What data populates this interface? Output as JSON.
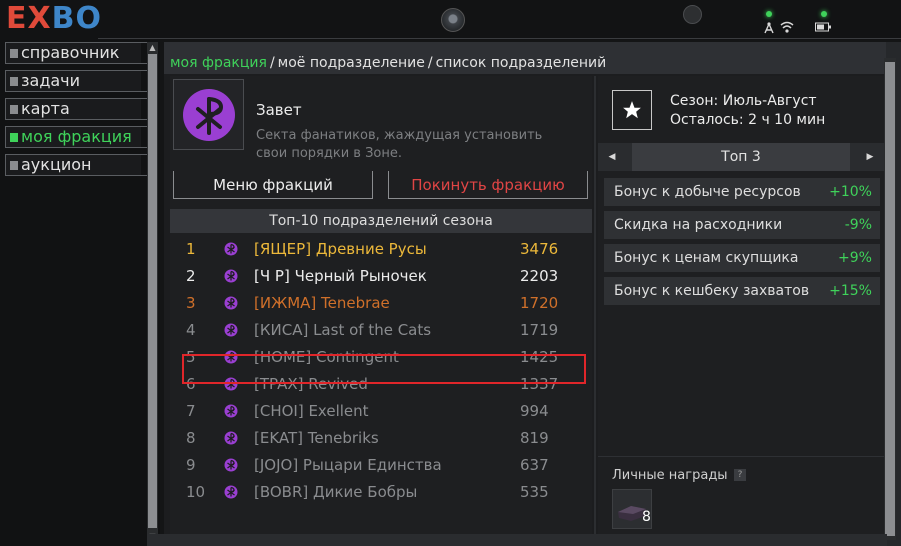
{
  "app": {
    "logo_part1": "EX",
    "logo_part2": "BO"
  },
  "sidebar": {
    "items": [
      {
        "label": "справочник",
        "active": false
      },
      {
        "label": "задачи",
        "active": false
      },
      {
        "label": "карта",
        "active": false
      },
      {
        "label": "моя фракция",
        "active": true
      },
      {
        "label": "аукцион",
        "active": false
      }
    ]
  },
  "breadcrumb": {
    "items": [
      "моя фракция",
      "моё подразделение",
      "список подразделений"
    ],
    "separator": "/"
  },
  "faction": {
    "name": "Завет",
    "description": "Секта фанатиков, жаждущая установить свои порядки в Зоне.",
    "emblem_icon": "chi-rho-emblem-icon",
    "menu_button": "Меню фракций",
    "leave_button": "Покинуть фракцию"
  },
  "leaderboard": {
    "title": "Топ-10 подразделений сезона",
    "rows": [
      {
        "rank": "1",
        "name": "[ЯЩЕР] Древние Русы",
        "score": "3476",
        "color": "#ecb83a"
      },
      {
        "rank": "2",
        "name": "[Ч  Р] Черный Рыночек",
        "score": "2203",
        "color": "#ececec"
      },
      {
        "rank": "3",
        "name": "[ИЖМА] Tenebrae",
        "score": "1720",
        "color": "#d0702a"
      },
      {
        "rank": "4",
        "name": "[КИСА] Last of the Cats",
        "score": "1719",
        "color": "#8a8c8f",
        "highlighted": true
      },
      {
        "rank": "5",
        "name": "[HOME] Contingent",
        "score": "1425",
        "color": "#8a8c8f"
      },
      {
        "rank": "6",
        "name": "[TPAX] Revived",
        "score": "1337",
        "color": "#8a8c8f"
      },
      {
        "rank": "7",
        "name": "[CHOI] Exellent",
        "score": "994",
        "color": "#8a8c8f"
      },
      {
        "rank": "8",
        "name": "[EKAT] Tenebriks",
        "score": "819",
        "color": "#8a8c8f"
      },
      {
        "rank": "9",
        "name": "[JOJO] Рыцари Единства",
        "score": "637",
        "color": "#8a8c8f"
      },
      {
        "rank": "10",
        "name": "[BOBR] Дикие Бобры",
        "score": "535",
        "color": "#8a8c8f"
      }
    ]
  },
  "season": {
    "title": "Сезон: Июль-Август",
    "remaining": "Осталось: 2 ч 10 мин",
    "icon": "star-icon",
    "selector": "Топ 3"
  },
  "bonuses": [
    {
      "label": "Бонус к добыче ресурсов",
      "value": "+10%"
    },
    {
      "label": "Скидка на расходники",
      "value": "-9%"
    },
    {
      "label": "Бонус к ценам скупщика",
      "value": "+9%"
    },
    {
      "label": "Бонус к кешбеку захватов",
      "value": "+15%"
    }
  ],
  "rewards": {
    "title": "Личные награды",
    "help": "?",
    "item_count": "8"
  },
  "colors": {
    "accent": "#3fd25a",
    "danger": "#e04545",
    "highlight_border": "#e0262a",
    "emblem": "#9a3fd2"
  }
}
